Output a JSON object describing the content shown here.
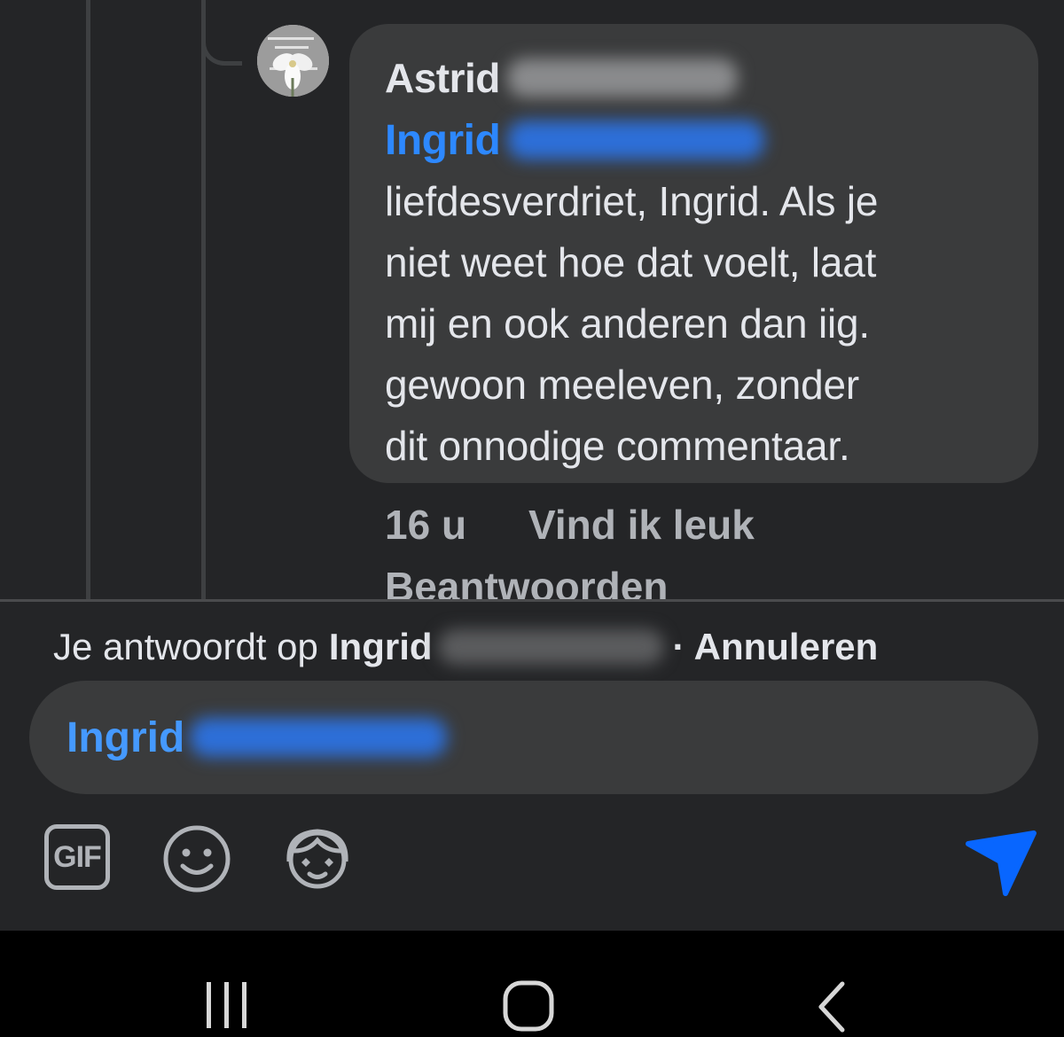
{
  "comment": {
    "author_first_name": "Astrid",
    "mention_first_name": "Ingrid",
    "text": "liefdesverdriet, Ingrid. Als je\nniet weet hoe dat voelt, laat\nmij en ook anderen dan iig.\ngewoon meeleven, zonder\ndit onnodige commentaar.",
    "time": "16 u",
    "like_label": "Vind ik leuk",
    "reply_label": "Beantwoorden"
  },
  "reply_bar": {
    "prefix": "Je antwoordt op",
    "name": "Ingrid",
    "cancel_label": "· Annuleren"
  },
  "composer": {
    "mention": "Ingrid"
  },
  "toolbar": {
    "gif_label": "GIF",
    "icons": [
      "gif-icon",
      "emoji-icon",
      "avatar-sticker-icon",
      "send-icon"
    ]
  },
  "system_nav": {
    "icons": [
      "recent-apps-icon",
      "home-icon",
      "back-icon"
    ]
  },
  "colors": {
    "background": "#242527",
    "bubble": "#3a3b3c",
    "mention_blue": "#2d88ff",
    "send_blue": "#0866ff",
    "nav_bar": "#000000"
  }
}
